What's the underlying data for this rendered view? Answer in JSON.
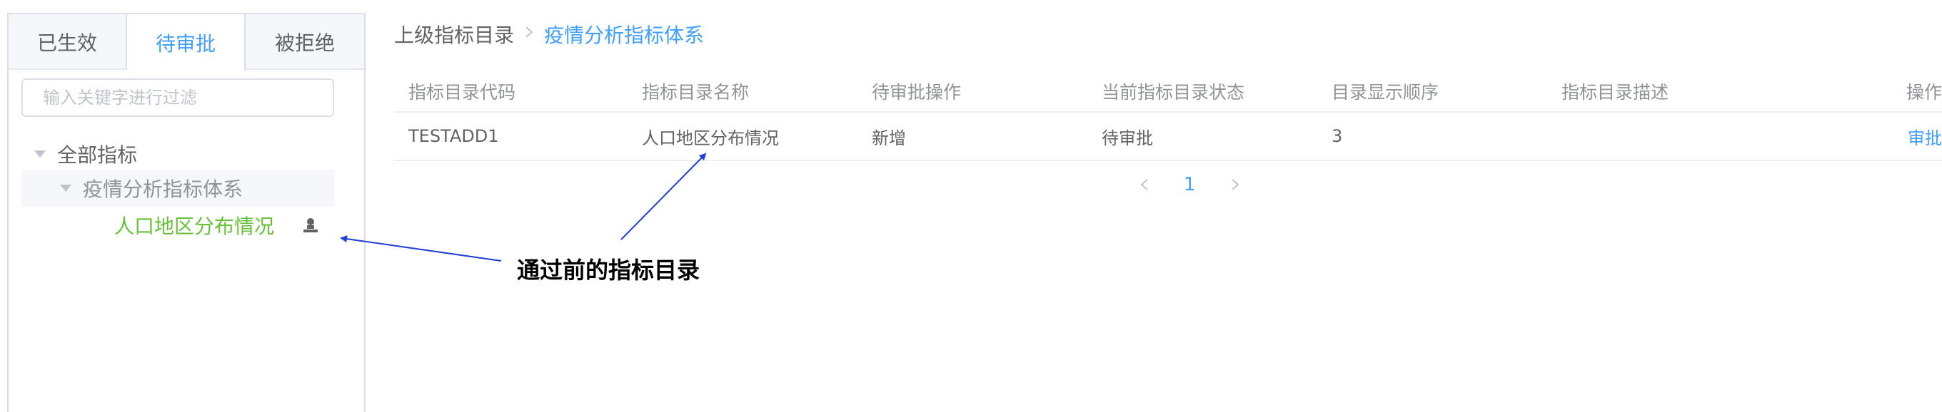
{
  "tabs": [
    "已生效",
    "待审批",
    "被拒绝"
  ],
  "active_tab": "待审批",
  "filter": {
    "placeholder": "输入关键字进行过滤",
    "value": ""
  },
  "tree": {
    "root": "全部指标",
    "child": "疫情分析指标体系",
    "leaf": "人口地区分布情况"
  },
  "breadcrumb": {
    "parent": "上级指标目录",
    "separator": ">",
    "current": "疫情分析指标体系"
  },
  "table": {
    "headers": [
      "指标目录代码",
      "指标目录名称",
      "待审批操作",
      "当前指标目录状态",
      "目录显示顺序",
      "指标目录描述",
      "操作"
    ],
    "rows": [
      [
        "TESTADD1",
        "人口地区分布情况",
        "新增",
        "待审批",
        "3",
        "",
        "审批"
      ]
    ]
  },
  "pagination": {
    "current_page": "1"
  },
  "annotation": {
    "text": "通过前的指标目录"
  },
  "colors": {
    "accent": "#409eff",
    "leaf": "#67c23a",
    "arrow": "#1f3fd6"
  },
  "icons": {
    "tree_leaf_action": "user-icon",
    "prev": "chevron-left-icon",
    "next": "chevron-right-icon"
  }
}
